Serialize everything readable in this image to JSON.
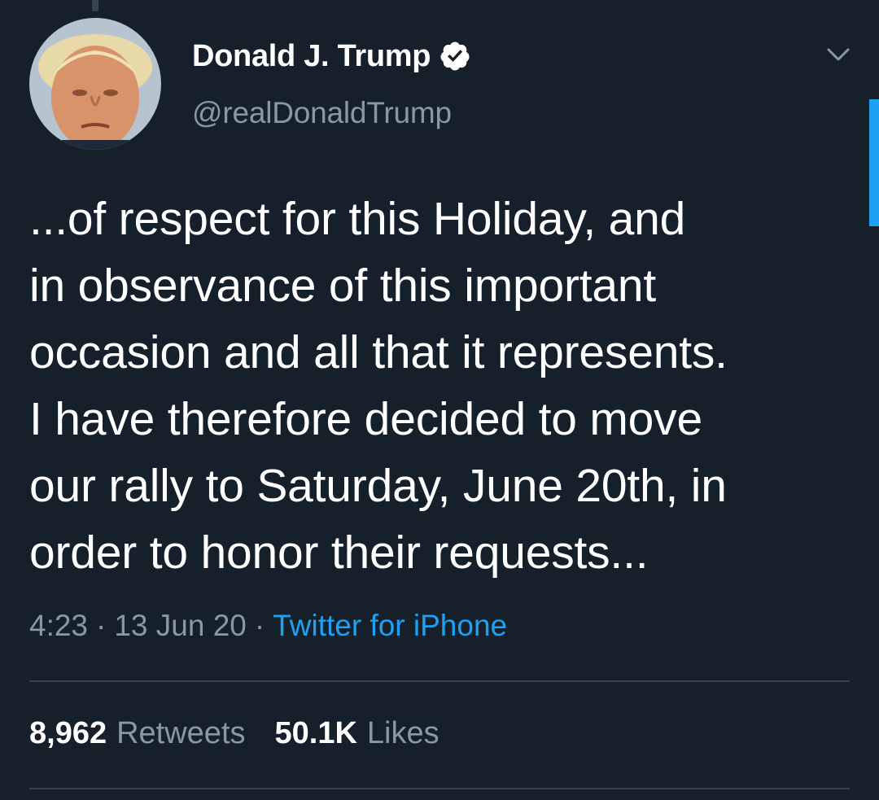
{
  "theme": {
    "background": "#15202b",
    "text_primary": "#ffffff",
    "text_secondary": "#8899a6",
    "accent": "#1da1f2",
    "divider": "#38444d"
  },
  "author": {
    "display_name": "Donald J. Trump",
    "handle": "@realDonaldTrump",
    "verified_icon": "verified-badge-icon",
    "avatar_icon": "profile-photo"
  },
  "menu": {
    "icon": "chevron-down-icon"
  },
  "tweet": {
    "text": "...of respect for this Holiday, and\nin observance of this important\noccasion and all that it represents.\nI have therefore decided to move\nour rally to Saturday, June 20th, in\norder to honor their requests..."
  },
  "meta": {
    "time": "4:23",
    "separator": "·",
    "date": "13 Jun 20",
    "source": "Twitter for iPhone"
  },
  "stats": {
    "retweets_count": "8,962",
    "retweets_label": "Retweets",
    "likes_count": "50.1K",
    "likes_label": "Likes"
  }
}
